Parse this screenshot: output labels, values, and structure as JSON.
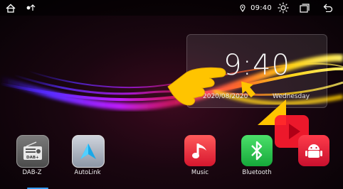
{
  "status_bar": {
    "time": "09:40",
    "icons": [
      "home-icon",
      "signal-indicator-icon",
      "location-icon",
      "brightness-icon",
      "recent-apps-icon",
      "back-icon"
    ]
  },
  "clock_widget": {
    "time": "9:40",
    "date": "2020/08/2020",
    "day": "Wednesday"
  },
  "dock": {
    "apps": [
      {
        "label": "DAB-Z",
        "icon": "radio-icon",
        "badge": "DAB+"
      },
      {
        "label": "AutoLink",
        "icon": "autolink-icon"
      },
      {
        "label": "Music",
        "icon": "music-note-icon"
      },
      {
        "label": "Bluetooth",
        "icon": "bluetooth-icon"
      },
      {
        "label": "",
        "icon": "android-icon"
      }
    ]
  },
  "colors": {
    "accent_yellow": "#ffc400",
    "music_red": "#e8263a",
    "bluetooth_green": "#22c04a",
    "overlay_red": "#ff1a2e",
    "indicator_blue": "#3aa0ff"
  }
}
